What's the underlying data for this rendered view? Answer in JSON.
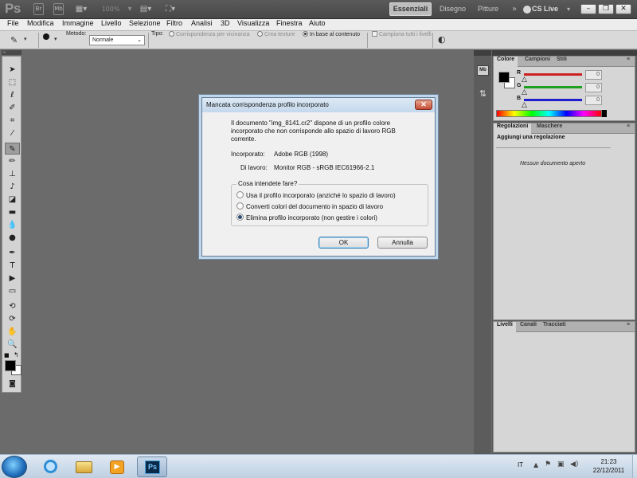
{
  "app": {
    "logo": "Ps",
    "zoom": "100%",
    "workspaces": {
      "active": "Essenziali",
      "others": [
        "Disegno",
        "Pitture"
      ]
    },
    "cslive": "CS Live",
    "mini_bridge": "Mb"
  },
  "menu": [
    "File",
    "Modifica",
    "Immagine",
    "Livello",
    "Selezione",
    "Filtro",
    "Analisi",
    "3D",
    "Visualizza",
    "Finestra",
    "Aiuto"
  ],
  "options": {
    "brush_size": "19",
    "mode_label": "Metodo:",
    "mode_value": "Normale",
    "type_label": "Tipo:",
    "type_options": [
      "Corrispondenza per vicinanza",
      "Crea texture",
      "In base al contenuto"
    ],
    "sample_all": "Campiona tutti i livelli"
  },
  "panels": {
    "color_tabs": [
      "Colore",
      "Campioni",
      "Stili"
    ],
    "channels": [
      {
        "label": "R",
        "value": "0",
        "color": "#cc2020"
      },
      {
        "label": "G",
        "value": "0",
        "color": "#20a020"
      },
      {
        "label": "B",
        "value": "0",
        "color": "#2020cc"
      }
    ],
    "adjust_tabs": [
      "Regolazioni",
      "Maschere"
    ],
    "adjust_heading": "Aggiungi una regolazione",
    "adjust_empty": "Nessun documento aperto",
    "layer_tabs": [
      "Livelli",
      "Canali",
      "Tracciati"
    ]
  },
  "dialog": {
    "title": "Mancata corrispondenza profilo incorporato",
    "message_lines": [
      "Il documento \"img_8141.cr2\" dispone di un profilo colore",
      "incorporato che non corrisponde allo spazio di lavoro RGB",
      "corrente."
    ],
    "embedded_label": "Incorporato:",
    "embedded_value": "Adobe RGB (1998)",
    "working_label": "Di lavoro:",
    "working_value": "Monitor RGB - sRGB IEC61966-2.1",
    "group_label": "Cosa intendete fare?",
    "options": [
      {
        "label": "Usa il profilo incorporato (anziché lo spazio di lavoro)",
        "selected": false
      },
      {
        "label": "Converti colori del documento in spazio di lavoro",
        "selected": false
      },
      {
        "label": "Elimina profilo incorporato (non gestire i colori)",
        "selected": true
      }
    ],
    "ok": "OK",
    "cancel": "Annulla"
  },
  "taskbar": {
    "lang": "IT",
    "time": "21:23",
    "date": "22/12/2011"
  }
}
